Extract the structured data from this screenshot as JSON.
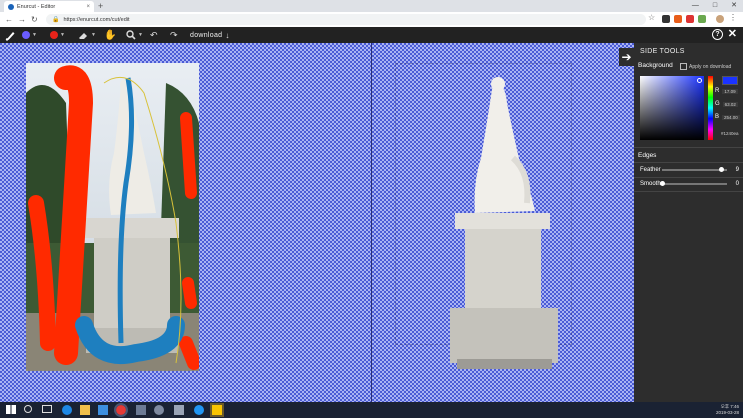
{
  "browser": {
    "tab_title": "Enurcut - Editor",
    "tab_close": "×",
    "new_tab": "+",
    "url": "https://enurcut.com/cut/edit",
    "window_controls": [
      "—",
      "□",
      "✕"
    ]
  },
  "toolbar": {
    "brush_color": "#6a5cff",
    "marker_color": "#e8231a",
    "download_label": "download",
    "download_icon": "↓"
  },
  "side_panel": {
    "title": "SIDE TOOLS",
    "toggle_icon": "➔",
    "background": {
      "label": "Background",
      "apply_label": "Apply on download",
      "color": "#1b33ff",
      "r_label": "R",
      "r_value": "17.09",
      "g_label": "G",
      "g_value": "63.02",
      "b_label": "B",
      "b_value": "254.00",
      "hex_value": "#1240ea"
    },
    "edges": {
      "label": "Edges",
      "feather_label": "Feather",
      "feather_value": "9",
      "feather_level": 0.9,
      "smooth_label": "Smooth",
      "smooth_value": "0",
      "smooth_level": 0.0
    }
  },
  "taskbar": {
    "time": "오후 7:46",
    "date": "2019-03-28"
  }
}
